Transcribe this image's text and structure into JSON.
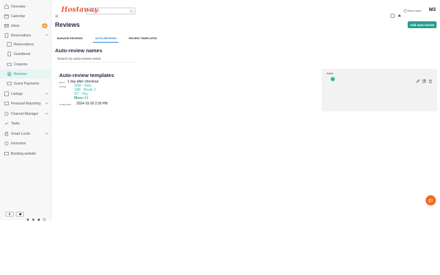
{
  "sidebar": {
    "items": [
      {
        "label": "Overview",
        "icon": "home-icon"
      },
      {
        "label": "Calendar",
        "icon": "calendar-icon"
      },
      {
        "label": "Inbox",
        "icon": "inbox-icon",
        "badge": "46"
      },
      {
        "label": "Reservations",
        "icon": "reservations-icon",
        "expanded": true
      },
      {
        "label": "Reservations",
        "icon": "list-icon"
      },
      {
        "label": "Guestbook",
        "icon": "book-icon"
      },
      {
        "label": "Coupons",
        "icon": "coupon-icon"
      },
      {
        "label": "Reviews",
        "icon": "star-icon",
        "active": true
      },
      {
        "label": "Guest Payments",
        "icon": "payment-icon"
      },
      {
        "label": "Listings",
        "icon": "listings-icon"
      },
      {
        "label": "Financial Reporting",
        "icon": "finance-icon"
      },
      {
        "label": "Channel Manager",
        "icon": "channel-icon"
      },
      {
        "label": "Tasks",
        "icon": "tasks-icon"
      },
      {
        "label": "Smart Locks",
        "icon": "lock-icon"
      },
      {
        "label": "Insurance",
        "icon": "insurance-icon"
      },
      {
        "label": "Booking website",
        "icon": "website-icon"
      }
    ]
  },
  "topbar": {
    "logo": "Hostaway",
    "search_placeholder": "Search",
    "help_label": "Need help?",
    "avatar_initials": "M3"
  },
  "page": {
    "title": "Reviews",
    "add_button": "Add auto-review"
  },
  "tabs": [
    {
      "label": "MANAGE REVIEWS",
      "active": false
    },
    {
      "label": "AUTO-REVIEWS",
      "active": true
    },
    {
      "label": "REVIEW TEMPLATES",
      "active": false
    }
  ],
  "auto_review": {
    "section_title": "Auto-review names",
    "search_placeholder": "Search by auto-review name"
  },
  "template": {
    "title": "Auto-review templates",
    "event_label": "Event:",
    "event_value": "1 day after checkout",
    "listings_label": "Listings:",
    "listings": [
      "32M - View",
      "16R - Route 2",
      "ST - Tiny"
    ],
    "more_label": "More",
    "more_count": "+49",
    "created_label": "Created date:",
    "created_value": "2024-10-29 2:26 PM"
  },
  "card": {
    "label": "Active",
    "toggle_on": true
  },
  "colors": {
    "accent": "#2a9d8f",
    "link": "#2ab5a8",
    "tab_active": "#2a7ed1",
    "badge": "#f5a142",
    "fab": "#f26b24",
    "logo": "#ee5a3a"
  }
}
